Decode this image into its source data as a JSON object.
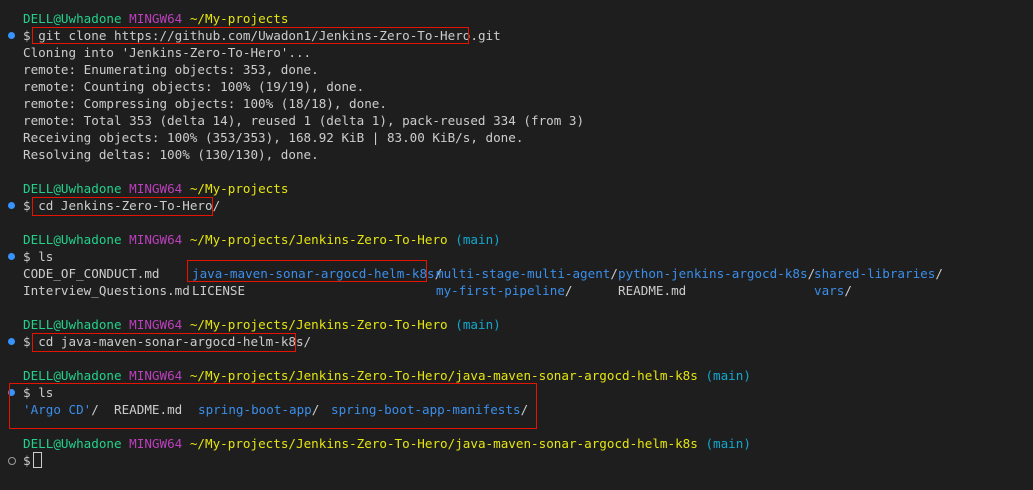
{
  "colors": {
    "background": "#1e1e1e",
    "user_host": "#23d18b",
    "shell": "#bc3fbc",
    "path": "#e5e510",
    "branch": "#11a8cd",
    "directory": "#3b8eea",
    "text": "#cccccc",
    "highlight_border": "#e51400",
    "status_dot": "#3794ff"
  },
  "prompt": {
    "user_host": "DELL@Uwhadone",
    "shell": "MINGW64",
    "symbol": "$"
  },
  "block1": {
    "path": "~/My-projects",
    "command": "git clone https://github.com/Uwadon1/Jenkins-Zero-To-Hero.git",
    "output": [
      "Cloning into 'Jenkins-Zero-To-Hero'...",
      "remote: Enumerating objects: 353, done.",
      "remote: Counting objects: 100% (19/19), done.",
      "remote: Compressing objects: 100% (18/18), done.",
      "remote: Total 353 (delta 14), reused 1 (delta 1), pack-reused 334 (from 3)",
      "Receiving objects: 100% (353/353), 168.92 KiB | 83.00 KiB/s, done.",
      "Resolving deltas: 100% (130/130), done."
    ]
  },
  "block2": {
    "path": "~/My-projects",
    "command": "cd Jenkins-Zero-To-Hero/"
  },
  "block3": {
    "path": "~/My-projects/Jenkins-Zero-To-Hero",
    "branch": "(main)",
    "command": "ls",
    "row1": {
      "c1": "CODE_OF_CONDUCT.md",
      "c2": "java-maven-sonar-argocd-helm-k8s",
      "c2_slash": "/",
      "c3": "multi-stage-multi-agent",
      "c3_slash": "/",
      "c4": "python-jenkins-argocd-k8s",
      "c4_slash": "/",
      "c5": "shared-libraries",
      "c5_slash": "/"
    },
    "row2": {
      "c1": "Interview_Questions.md",
      "c2": "LICENSE",
      "c3": "my-first-pipeline",
      "c3_slash": "/",
      "c4": "README.md",
      "c5": "vars",
      "c5_slash": "/"
    }
  },
  "block4": {
    "path": "~/My-projects/Jenkins-Zero-To-Hero",
    "branch": "(main)",
    "command": "cd java-maven-sonar-argocd-helm-k8s/"
  },
  "block5": {
    "path": "~/My-projects/Jenkins-Zero-To-Hero/java-maven-sonar-argocd-helm-k8s",
    "branch": "(main)",
    "command": "ls",
    "entries": {
      "e1": "'Argo CD'",
      "e1_slash": "/",
      "e2": "README.md",
      "e3": "spring-boot-app",
      "e3_slash": "/",
      "e4": "spring-boot-app-manifests",
      "e4_slash": "/"
    }
  },
  "block6": {
    "path": "~/My-projects/Jenkins-Zero-To-Hero/java-maven-sonar-argocd-helm-k8s",
    "branch": "(main)"
  }
}
